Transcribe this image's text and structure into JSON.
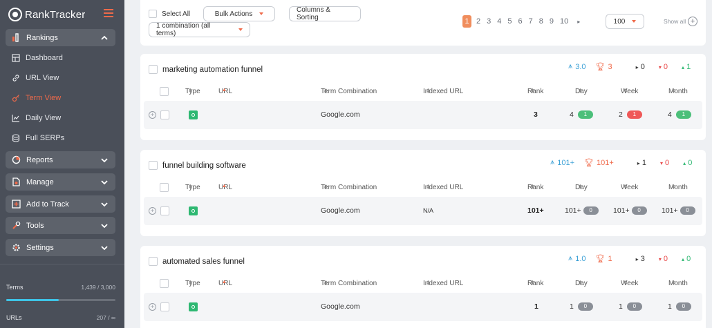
{
  "app": {
    "name": "RankTracker"
  },
  "sidebar": {
    "groups": [
      {
        "label": "Rankings",
        "expanded": true
      },
      {
        "label": "Reports"
      },
      {
        "label": "Manage"
      },
      {
        "label": "Add to Track"
      },
      {
        "label": "Tools"
      },
      {
        "label": "Settings"
      }
    ],
    "rankings_items": [
      {
        "label": "Dashboard"
      },
      {
        "label": "URL View"
      },
      {
        "label": "Term View",
        "active": true
      },
      {
        "label": "Daily View"
      },
      {
        "label": "Full SERPs"
      }
    ],
    "terms": {
      "label": "Terms",
      "value": "1,439 / 3,000",
      "used_fraction": 0.48
    },
    "urls": {
      "label": "URLs",
      "value": "207 / ∞"
    }
  },
  "toolbar": {
    "select_all": "Select All",
    "bulk_actions": "Bulk Actions",
    "columns_sorting": "Columns & Sorting",
    "combination": "1 combination (all terms)",
    "pages": [
      "1",
      "2",
      "3",
      "4",
      "5",
      "6",
      "7",
      "8",
      "9",
      "10"
    ],
    "current_page": "1",
    "per_page": "100",
    "show_all": "Show all"
  },
  "columns": {
    "type": "Type",
    "url": "URL",
    "term_combination": "Term Combination",
    "indexed_url": "Indexed URL",
    "rank": "Rank",
    "day": "Day",
    "week": "Week",
    "month": "Month"
  },
  "terms": [
    {
      "term": "marketing automation funnel",
      "avg": "3.0",
      "top": "3",
      "eq": "0",
      "down": "0",
      "up": "1",
      "row": {
        "engine": "Google.com",
        "indexed_url": "",
        "rank": "3",
        "day": "4",
        "day_change": "1",
        "day_color": "green",
        "week": "2",
        "week_change": "1",
        "week_color": "red",
        "month": "4",
        "month_change": "1",
        "month_color": "green"
      }
    },
    {
      "term": "funnel building software",
      "avg": "101+",
      "top": "101+",
      "eq": "1",
      "down": "0",
      "up": "0",
      "row": {
        "engine": "Google.com",
        "indexed_url": "N/A",
        "rank": "101+",
        "day": "101+",
        "day_change": "0",
        "day_color": "gray",
        "week": "101+",
        "week_change": "0",
        "week_color": "gray",
        "month": "101+",
        "month_change": "0",
        "month_color": "gray"
      }
    },
    {
      "term": "automated sales funnel",
      "avg": "1.0",
      "top": "1",
      "eq": "3",
      "down": "0",
      "up": "0",
      "row": {
        "engine": "Google.com",
        "indexed_url": "",
        "rank": "1",
        "day": "1",
        "day_change": "0",
        "day_color": "gray",
        "week": "1",
        "week_change": "0",
        "week_color": "gray",
        "month": "1",
        "month_change": "0",
        "month_color": "gray"
      }
    }
  ]
}
